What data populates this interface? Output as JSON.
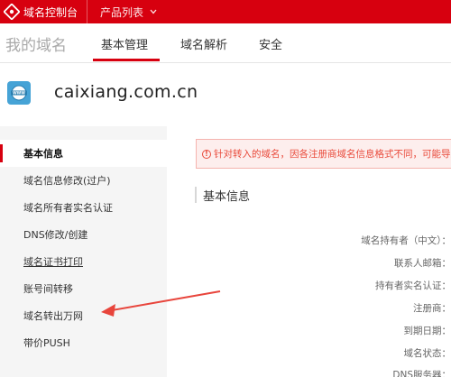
{
  "topbar": {
    "brand": "域名控制台",
    "products": "产品列表"
  },
  "subnav": {
    "title": "我的域名",
    "tabs": [
      "基本管理",
      "域名解析",
      "安全"
    ],
    "active_tab": "基本管理"
  },
  "domain": {
    "name": "caixiang.com.cn"
  },
  "sidebar": {
    "items": [
      {
        "label": "基本信息"
      },
      {
        "label": "域名信息修改(过户)"
      },
      {
        "label": "域名所有者实名认证"
      },
      {
        "label": "DNS修改/创建"
      },
      {
        "label": "域名证书打印"
      },
      {
        "label": "账号间转移"
      },
      {
        "label": "域名转出万网"
      },
      {
        "label": "带价PUSH"
      }
    ],
    "active_index": 0
  },
  "notice": {
    "text": "针对转入的域名，因各注册商域名信息格式不同，可能导致"
  },
  "basic_info": {
    "title": "基本信息",
    "fields": [
      "域名持有者（中文）：",
      "联系人邮箱：",
      "持有者实名认证：",
      "注册商：",
      "到期日期：",
      "域名状态：",
      "DNS服务器："
    ]
  },
  "colors": {
    "brand_red": "#d7000f",
    "notice_red": "#e94b3c",
    "sidebar_bg": "#f5f5f5"
  },
  "icons": [
    "aliyun-logo-icon",
    "chevron-down-icon",
    "www-globe-icon",
    "warning-circle-icon",
    "annotation-arrow"
  ]
}
